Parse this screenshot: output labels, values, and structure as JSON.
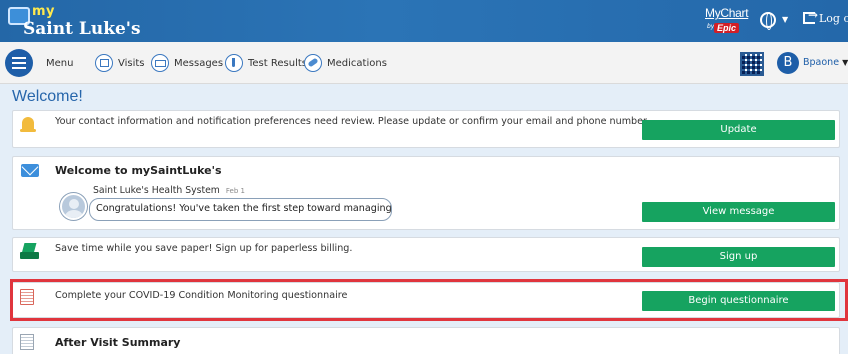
{
  "header": {
    "logo_my": "my",
    "logo_name": "Saint Luke's",
    "mychart": "MyChart",
    "by": "by",
    "epic": "Epic",
    "logout": "Log out"
  },
  "nav": {
    "menu": "Menu",
    "items": [
      {
        "label": "Visits",
        "icon": "calendar-icon"
      },
      {
        "label": "Messages",
        "icon": "envelope-icon"
      },
      {
        "label": "Test Results",
        "icon": "flask-icon"
      },
      {
        "label": "Medications",
        "icon": "pill-icon"
      }
    ],
    "avatar_letter": "B",
    "username": "Bpaone"
  },
  "main": {
    "welcome": "Welcome!",
    "cards": {
      "contact": {
        "text": "Your contact information and notification preferences need review. Please update or confirm your email and phone number.",
        "button": "Update"
      },
      "message": {
        "heading": "Welcome to mySaintLuke's",
        "sender": "Saint Luke's Health System",
        "date": "Feb 1",
        "preview": "Congratulations! You've taken the first step toward managing your…",
        "button": "View message"
      },
      "billing": {
        "text": "Save time while you save paper! Sign up for paperless billing.",
        "button": "Sign up"
      },
      "questionnaire": {
        "text": "Complete your COVID-19 Condition Monitoring questionnaire",
        "button": "Begin questionnaire"
      },
      "avs": {
        "heading": "After Visit Summary"
      }
    }
  },
  "colors": {
    "header": "#2b74b6",
    "primary": "#1e5ea8",
    "button": "#16a360",
    "highlight": "#e0353d",
    "background": "#e4eef8"
  }
}
